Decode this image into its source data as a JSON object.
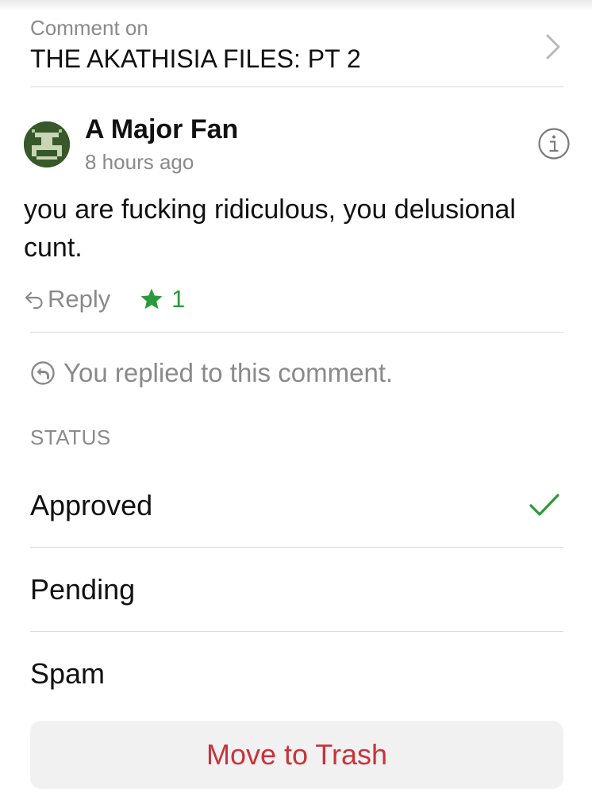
{
  "post": {
    "caption": "Comment on",
    "title": "THE AKATHISIA FILES: PT 2",
    "chevron_icon": "chevron-right-icon"
  },
  "comment": {
    "author": "A Major Fan",
    "timestamp": "8 hours ago",
    "body": "you are fucking ridiculous, you delusional cunt.",
    "avatar_icon": "pixel-invader-avatar",
    "info_icon": "info-icon"
  },
  "actions": {
    "reply_label": "Reply",
    "reply_icon": "reply-arrow-icon",
    "like_count": "1",
    "like_icon": "star-icon"
  },
  "replied_note": {
    "text": "You replied to this comment.",
    "icon": "reply-circle-icon"
  },
  "status": {
    "heading": "STATUS",
    "options": [
      {
        "label": "Approved",
        "selected": true
      },
      {
        "label": "Pending",
        "selected": false
      },
      {
        "label": "Spam",
        "selected": false
      }
    ]
  },
  "trash_button_label": "Move to Trash",
  "colors": {
    "accent_green": "#2a9a3a",
    "destructive_red": "#c9333a",
    "secondary_text": "#8a8a8a"
  }
}
